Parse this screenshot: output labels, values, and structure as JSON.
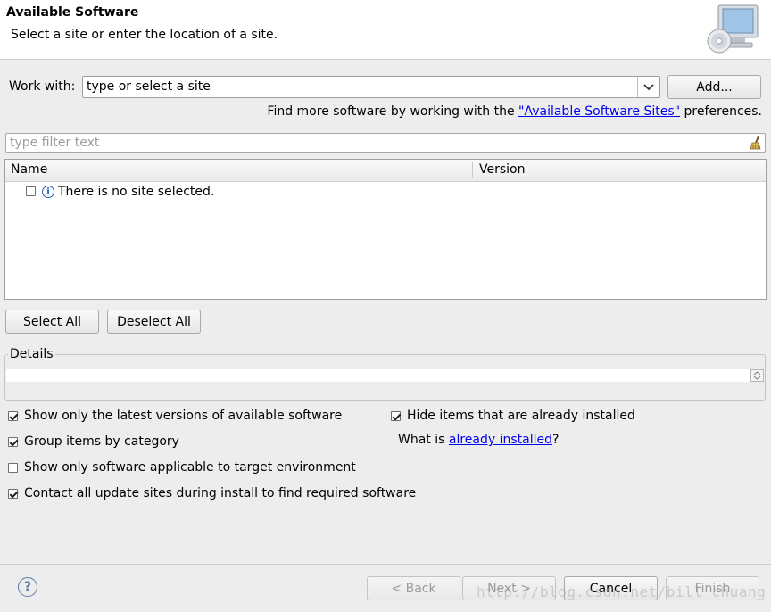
{
  "header": {
    "title": "Available Software",
    "subtitle": "Select a site or enter the location of a site."
  },
  "work_with": {
    "label": "Work with:",
    "value": "type or select a site",
    "add_button": "Add..."
  },
  "more_software": {
    "prefix": "Find more software by working with the ",
    "link": "\"Available Software Sites\"",
    "suffix": " preferences."
  },
  "filter": {
    "placeholder": "type filter text"
  },
  "table": {
    "columns": [
      "Name",
      "Version"
    ],
    "rows": [
      {
        "name": "There is no site selected.",
        "checked": false
      }
    ]
  },
  "selection_buttons": {
    "select_all": "Select All",
    "deselect_all": "Deselect All"
  },
  "details": {
    "label": "Details"
  },
  "options": {
    "latest_versions": {
      "label": "Show only the latest versions of available software",
      "checked": true
    },
    "group_by_category": {
      "label": "Group items by category",
      "checked": true
    },
    "target_env": {
      "label": "Show only software applicable to target environment",
      "checked": false
    },
    "contact_sites": {
      "label": "Contact all update sites during install to find required software",
      "checked": true
    },
    "hide_installed": {
      "label": "Hide items that are already installed",
      "checked": true
    },
    "what_is": {
      "prefix": "What is ",
      "link": "already installed",
      "suffix": "?"
    }
  },
  "footer": {
    "back": "< Back",
    "next": "Next >",
    "cancel": "Cancel",
    "finish": "Finish",
    "watermark": "http://blog.csdn.net/bill_chuang"
  },
  "colors": {
    "link": "#0000ee",
    "background": "#ededed"
  }
}
